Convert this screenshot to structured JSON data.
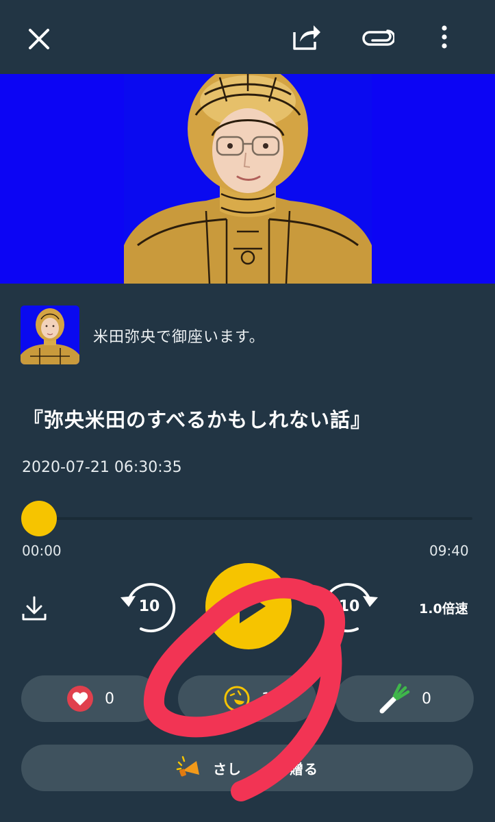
{
  "topbar": {
    "close_icon": "close-icon",
    "share_icon": "share-icon",
    "attach_icon": "paperclip-icon",
    "more_icon": "more-vertical-icon"
  },
  "channel": {
    "name": "米田弥央で御座います。"
  },
  "episode": {
    "title": "『弥央米田のすべるかもしれない話』",
    "date": "2020-07-21 06:30:35"
  },
  "player": {
    "progress": 0,
    "current_time": "00:00",
    "duration": "09:40",
    "rewind_seconds": "10",
    "forward_seconds": "10",
    "speed_label": "1.0倍速"
  },
  "reactions": {
    "likes": "0",
    "laugh": "1",
    "negi": "0"
  },
  "gift": {
    "label_visible_left": "さし",
    "label_visible_right": "贈る"
  },
  "colors": {
    "background": "#223544",
    "accent": "#f6c400",
    "pill": "#3f525e",
    "like": "#e0404d",
    "annotation": "#f23454"
  }
}
